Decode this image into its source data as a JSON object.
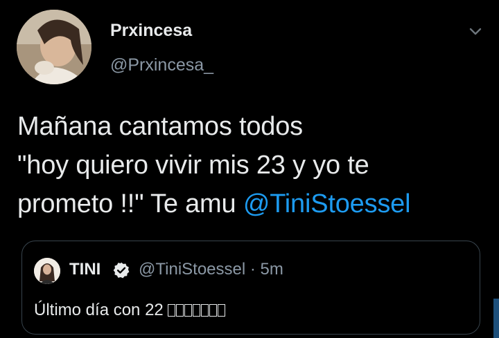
{
  "author": {
    "display_name": "Prxincesa",
    "handle": "@Prxincesa_"
  },
  "tweet": {
    "line1": "Mañana cantamos todos",
    "line2": "\"hoy quiero vivir mis 23 y yo te",
    "line3_prefix": "prometo !!\" Te amu ",
    "mention": "@TiniStoessel"
  },
  "quoted_tweet": {
    "display_name": "TINI",
    "handle_time": "@TiniStoessel · 5m",
    "text": "Último día con 22",
    "emoji_placeholder_count": 7
  },
  "icons": {
    "caret": "chevron-down-icon",
    "verified": "verified-badge-icon"
  },
  "colors": {
    "background": "#000000",
    "text": "#e8eaeb",
    "secondary": "#8b98a5",
    "accent": "#1d9bf0",
    "border": "#38444d"
  }
}
